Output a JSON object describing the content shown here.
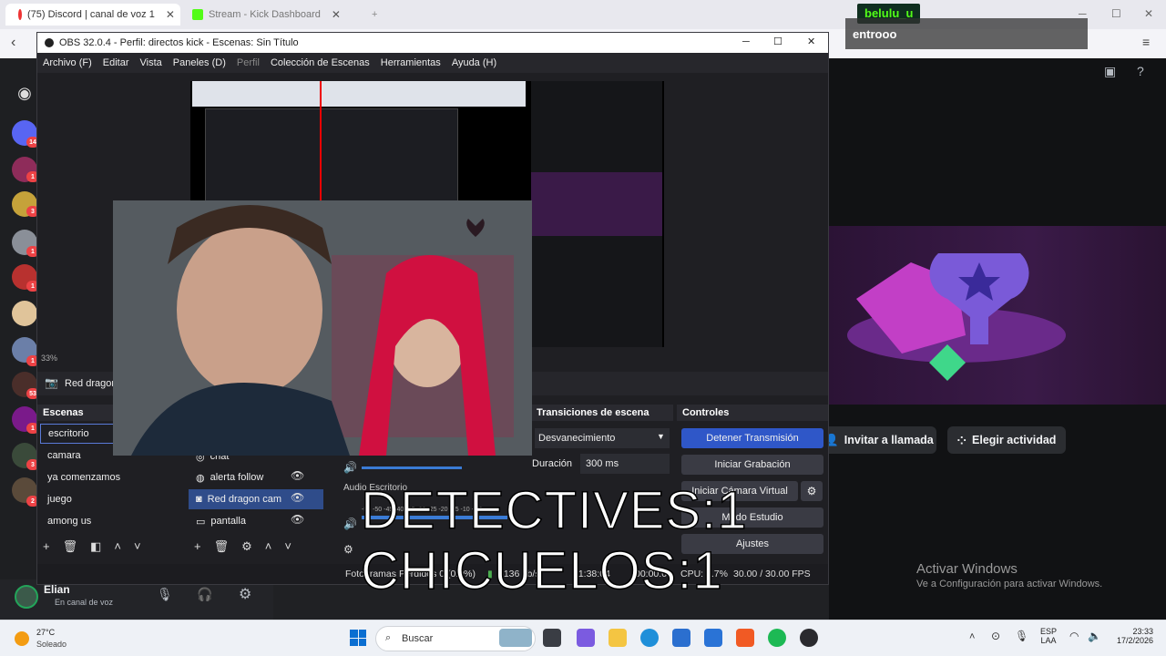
{
  "browser": {
    "tabs": [
      {
        "label": "(75) Discord | canal de voz 1",
        "color": "#5865f2"
      },
      {
        "label": "Stream - Kick Dashboard",
        "color": "#53fc18"
      }
    ],
    "new_tab": "+",
    "close": "✕"
  },
  "overlay": {
    "username": "belulu_u",
    "chat_message": "entrooo",
    "line1": "DETECTIVES:1",
    "line2": "CHICUELOS:1"
  },
  "discord": {
    "badges": [
      "14",
      "1",
      "3",
      "1",
      "1",
      "1",
      "53",
      "1",
      "3",
      "2"
    ],
    "invite_label": "Invitar a llamada",
    "activity_label": "Elegir actividad",
    "user_name": "Elian",
    "user_status": "En canal de voz",
    "activate_title": "Activar Windows",
    "activate_sub": "Ve a Configuración para activar Windows."
  },
  "obs": {
    "title": "OBS 32.0.4 - Perfil: directos kick - Escenas: Sin Título",
    "menu": [
      "Archivo (F)",
      "Editar",
      "Vista",
      "Paneles (D)",
      "Perfil",
      "Colección de Escenas",
      "Herramientas",
      "Ayuda (H)"
    ],
    "zoom": "33%",
    "source_bar_label": "Red dragon",
    "scenes_title": "Escenas",
    "scenes": [
      "escritorio",
      "camara",
      "ya comenzamos",
      "juego",
      "among us"
    ],
    "sources": [
      "chat",
      "alerta follow",
      "Red dragon cam",
      "pantalla"
    ],
    "mixer_title": "Audio Escritorio",
    "mixer_scale": "-55 -50 -45 -40 -35 -30 -25 -20 -15 -10 -5 0",
    "transitions_title": "Transiciones de escena",
    "transition_value": "Desvanecimiento",
    "duration_label": "Duración",
    "duration_value": "300 ms",
    "controls_title": "Controles",
    "controls": [
      "Detener Transmisión",
      "Iniciar Grabación",
      "Iniciar Cámara Virtual",
      "Modo Estudio",
      "Ajustes"
    ],
    "status_dropped": "Fotogramas Perdidos 0 (0.0%)",
    "status_kbps": "6136 kb/s",
    "status_time": "01:38:04",
    "status_rec": "00:00:00",
    "status_cpu": "CPU: 2.7%",
    "status_fps": "30.00 / 30.00 FPS"
  },
  "taskbar": {
    "weather_temp": "27°C",
    "weather_desc": "Soleado",
    "search": "Buscar",
    "lang": "ESP",
    "lang2": "LAA",
    "time": "23:33",
    "date": "17/2/2026"
  }
}
